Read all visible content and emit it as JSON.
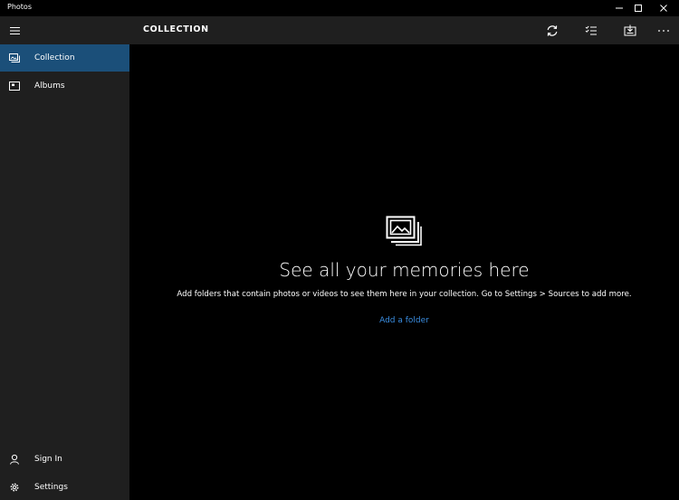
{
  "window": {
    "title": "Photos"
  },
  "sidebar": {
    "items": [
      {
        "label": "Collection",
        "icon": "collection-icon",
        "active": true
      },
      {
        "label": "Albums",
        "icon": "album-icon",
        "active": false
      }
    ],
    "bottom_items": [
      {
        "label": "Sign In",
        "icon": "person-icon"
      },
      {
        "label": "Settings",
        "icon": "gear-icon"
      }
    ]
  },
  "header": {
    "title": "COLLECTION",
    "tools": [
      "refresh-icon",
      "select-icon",
      "import-icon",
      "more-icon"
    ]
  },
  "empty_state": {
    "headline": "See all your memories here",
    "description": "Add folders that contain photos or videos to see them here in your collection. Go to Settings > Sources to add more.",
    "link": "Add a folder"
  },
  "colors": {
    "accent": "#1b4f79",
    "link": "#3a8de0",
    "pane": "#1f1f1f",
    "background": "#000000"
  }
}
